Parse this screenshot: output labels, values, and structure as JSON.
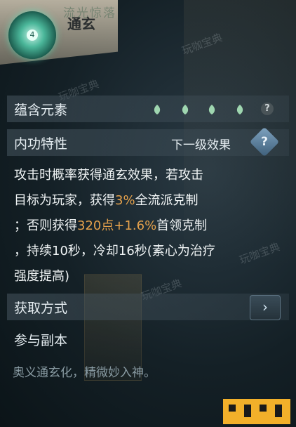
{
  "header": {
    "title": "通玄",
    "subtitle_faded": "流光惊落",
    "icon": "skill-orb-icon",
    "icon_badge": "4"
  },
  "elements": {
    "label": "蕴含元素",
    "leaves": [
      "leaf-icon",
      "leaf-icon",
      "leaf-icon",
      "leaf-icon"
    ],
    "help_label": "?"
  },
  "neigong": {
    "label": "内功特性",
    "next_level_label": "下一级效果",
    "help_label": "?"
  },
  "description": {
    "line1": "攻击时概率获得通玄效果，若攻击",
    "line2_a": "目标为玩家，获得",
    "line2_hl": "3%",
    "line2_b": "全流派克制",
    "line3_a": "；否则获得",
    "line3_hl": "320点+1.6%",
    "line3_b": "首领克制",
    "line4": "，持续10秒，冷却16秒(素心为治疗",
    "line5": "强度提高)"
  },
  "acquire": {
    "label": "获取方式",
    "arrow": "›",
    "method": "参与副本"
  },
  "flavor": "奥义通玄化，精微妙入神。",
  "watermarks": [
    "玩咖宝典",
    "玩咖宝典",
    "玩咖宝典",
    "玩咖宝典"
  ],
  "colors": {
    "highlight": "#e6a24c",
    "leaf": "#9fd6b0"
  }
}
